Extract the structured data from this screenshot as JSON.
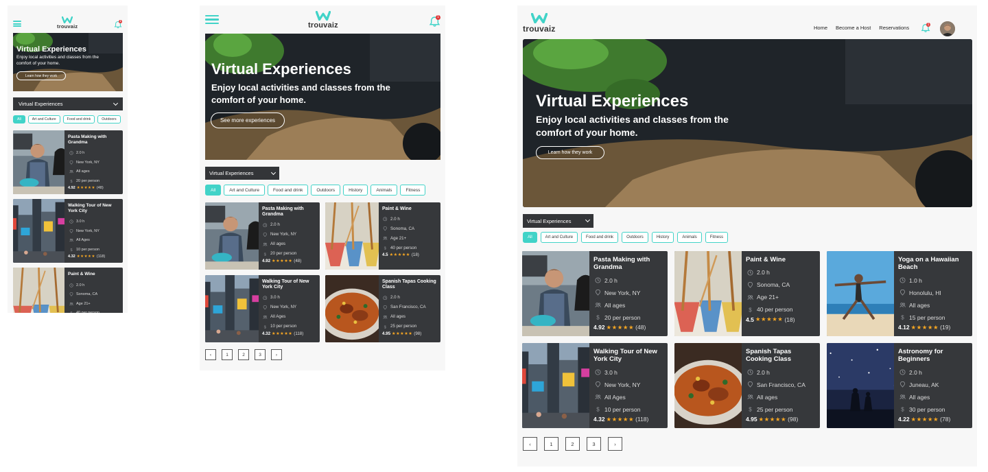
{
  "brand": {
    "name": "trouvaiz",
    "accent": "#41d3c8",
    "notification_count": "1"
  },
  "nav": {
    "links": [
      "Home",
      "Become a Host",
      "Reservations"
    ]
  },
  "hero": {
    "title": "Virtual Experiences",
    "subtitle": "Enjoy local activities and classes from the comfort of your home.",
    "cta_how": "Learn how they work",
    "cta_more": "See more experiences"
  },
  "select": {
    "value": "Virtual Experiences"
  },
  "chips": [
    "All",
    "Art and Culture",
    "Food and drink",
    "Outdoors",
    "History",
    "Animals",
    "Fitness"
  ],
  "icons": {
    "duration": "clock-icon",
    "location": "pin-icon",
    "ages": "people-icon",
    "price": "dollar-icon"
  },
  "experiences": [
    {
      "title": "Pasta Making with Grandma",
      "duration": "2.0 h",
      "location": "New York, NY",
      "ages": "All ages",
      "price": "20 per person",
      "rating": "4.92",
      "count": "(48)",
      "photo": "pasta"
    },
    {
      "title": "Paint & Wine",
      "duration": "2.0 h",
      "location": "Sonoma, CA",
      "ages": "Age 21+",
      "price": "40 per person",
      "rating": "4.5",
      "count": "(18)",
      "photo": "paint"
    },
    {
      "title": "Yoga on a Hawaiian Beach",
      "duration": "1.0 h",
      "location": "Honolulu, HI",
      "ages": "All ages",
      "price": "15 per person",
      "rating": "4.12",
      "count": "(19)",
      "photo": "yoga"
    },
    {
      "title": "Walking Tour of New York City",
      "duration": "3.0 h",
      "location": "New York, NY",
      "ages": "All Ages",
      "price": "10 per person",
      "rating": "4.32",
      "count": "(118)",
      "photo": "city"
    },
    {
      "title": "Spanish Tapas Cooking Class",
      "duration": "2.0 h",
      "location": "San Francisco, CA",
      "ages": "All ages",
      "price": "25 per person",
      "rating": "4.95",
      "count": "(98)",
      "photo": "paella"
    },
    {
      "title": "Astronomy for Beginners",
      "duration": "2.0 h",
      "location": "Juneau, AK",
      "ages": "All ages",
      "price": "30 per person",
      "rating": "4.22",
      "count": "(78)",
      "photo": "stars"
    }
  ],
  "stars": "★★★★★",
  "pagination": {
    "prev": "‹",
    "pages": [
      "1",
      "2",
      "3"
    ],
    "next": "›"
  }
}
